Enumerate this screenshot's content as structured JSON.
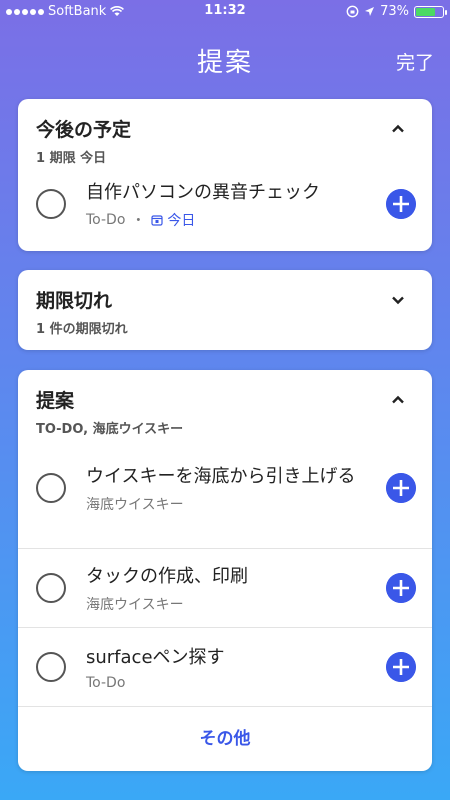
{
  "status_bar": {
    "carrier": "SoftBank",
    "time": "11:32",
    "battery_percent": "73%",
    "battery_level": 0.73
  },
  "header": {
    "title": "提案",
    "done_label": "完了"
  },
  "upcoming": {
    "title": "今後の予定",
    "subtitle": "1 期限 今日",
    "tasks": [
      {
        "name": "自作パソコンの異音チェック",
        "list": "To-Do",
        "separator": "・",
        "due": "今日"
      }
    ]
  },
  "overdue": {
    "title": "期限切れ",
    "subtitle": "1 件の期限切れ"
  },
  "suggestions": {
    "title": "提案",
    "subtitle": "TO-DO, 海底ウイスキー",
    "tasks": [
      {
        "name": "ウイスキーを海底から引き上げる",
        "list": "海底ウイスキー"
      },
      {
        "name": "タックの作成、印刷",
        "list": "海底ウイスキー"
      },
      {
        "name": "surfaceペン探す",
        "list": "To-Do"
      }
    ],
    "more_label": "その他"
  },
  "colors": {
    "accent": "#3a57e8",
    "gradient_top": "#7b6fe6",
    "gradient_bottom": "#3aa8f6"
  }
}
